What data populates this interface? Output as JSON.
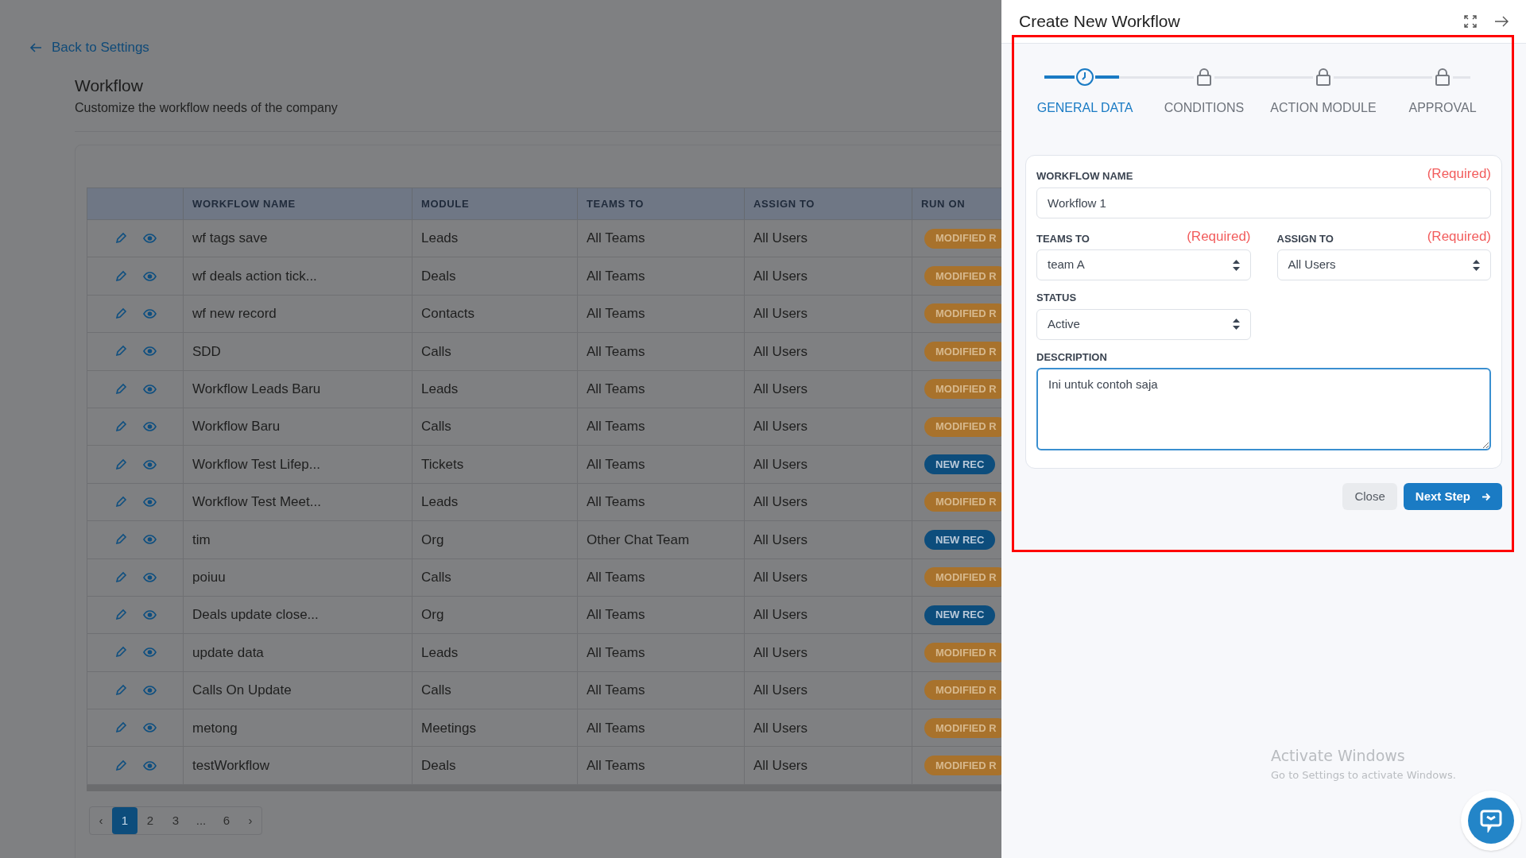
{
  "back_link": "Back to Settings",
  "page": {
    "title": "Workflow",
    "subtitle": "Customize the workflow needs of the company"
  },
  "table": {
    "columns": [
      "WORKFLOW NAME",
      "MODULE",
      "TEAMS TO",
      "ASSIGN TO",
      "RUN ON"
    ],
    "rows": [
      {
        "name": "wf tags save",
        "module": "Leads",
        "teams": "All Teams",
        "assign": "All Users",
        "run_on": {
          "text": "MODIFIED R",
          "kind": "modified"
        }
      },
      {
        "name": "wf deals action tick...",
        "module": "Deals",
        "teams": "All Teams",
        "assign": "All Users",
        "run_on": {
          "text": "MODIFIED R",
          "kind": "modified"
        }
      },
      {
        "name": "wf new record",
        "module": "Contacts",
        "teams": "All Teams",
        "assign": "All Users",
        "run_on": {
          "text": "MODIFIED R",
          "kind": "modified"
        }
      },
      {
        "name": "SDD",
        "module": "Calls",
        "teams": "All Teams",
        "assign": "All Users",
        "run_on": {
          "text": "MODIFIED R",
          "kind": "modified"
        }
      },
      {
        "name": "Workflow Leads Baru",
        "module": "Leads",
        "teams": "All Teams",
        "assign": "All Users",
        "run_on": {
          "text": "MODIFIED R",
          "kind": "modified"
        }
      },
      {
        "name": "Workflow Baru",
        "module": "Calls",
        "teams": "All Teams",
        "assign": "All Users",
        "run_on": {
          "text": "MODIFIED R",
          "kind": "modified"
        }
      },
      {
        "name": "Workflow Test Lifep...",
        "module": "Tickets",
        "teams": "All Teams",
        "assign": "All Users",
        "run_on": {
          "text": "NEW REC",
          "kind": "new"
        }
      },
      {
        "name": "Workflow Test Meet...",
        "module": "Leads",
        "teams": "All Teams",
        "assign": "All Users",
        "run_on": {
          "text": "MODIFIED R",
          "kind": "modified"
        }
      },
      {
        "name": "tim",
        "module": "Org",
        "teams": "Other Chat Team",
        "assign": "All Users",
        "run_on": {
          "text": "NEW REC",
          "kind": "new"
        }
      },
      {
        "name": "poiuu",
        "module": "Calls",
        "teams": "All Teams",
        "assign": "All Users",
        "run_on": {
          "text": "MODIFIED R",
          "kind": "modified"
        }
      },
      {
        "name": "Deals update close...",
        "module": "Org",
        "teams": "All Teams",
        "assign": "All Users",
        "run_on": {
          "text": "NEW REC",
          "kind": "new"
        }
      },
      {
        "name": "update data",
        "module": "Leads",
        "teams": "All Teams",
        "assign": "All Users",
        "run_on": {
          "text": "MODIFIED R",
          "kind": "modified"
        }
      },
      {
        "name": "Calls On Update",
        "module": "Calls",
        "teams": "All Teams",
        "assign": "All Users",
        "run_on": {
          "text": "MODIFIED R",
          "kind": "modified"
        }
      },
      {
        "name": "metong",
        "module": "Meetings",
        "teams": "All Teams",
        "assign": "All Users",
        "run_on": {
          "text": "MODIFIED R",
          "kind": "modified"
        }
      },
      {
        "name": "testWorkflow",
        "module": "Deals",
        "teams": "All Teams",
        "assign": "All Users",
        "run_on": {
          "text": "MODIFIED R",
          "kind": "modified"
        }
      }
    ]
  },
  "pagination": [
    {
      "label": "‹",
      "kind": "arrow",
      "selected": false
    },
    {
      "label": "1",
      "kind": "page",
      "selected": true
    },
    {
      "label": "2",
      "kind": "page",
      "selected": false
    },
    {
      "label": "3",
      "kind": "page",
      "selected": false
    },
    {
      "label": "...",
      "kind": "gap",
      "selected": false
    },
    {
      "label": "6",
      "kind": "page",
      "selected": false
    },
    {
      "label": "›",
      "kind": "arrow",
      "selected": false
    }
  ],
  "panel": {
    "title": "Create New Workflow",
    "steps": [
      {
        "label": "GENERAL DATA",
        "selected": true
      },
      {
        "label": "CONDITIONS",
        "selected": false
      },
      {
        "label": "ACTION MODULE",
        "selected": false
      },
      {
        "label": "APPROVAL",
        "selected": false
      }
    ],
    "workflow_name": {
      "label": "WORKFLOW NAME",
      "required": "(Required)",
      "value": "Workflow 1"
    },
    "teams_to": {
      "label": "TEAMS TO",
      "required": "(Required)",
      "value": "team A"
    },
    "assign_to": {
      "label": "ASSIGN TO",
      "required": "(Required)",
      "value": "All Users"
    },
    "status": {
      "label": "STATUS",
      "value": "Active"
    },
    "description": {
      "label": "DESCRIPTION",
      "value": "Ini untuk contoh saja"
    },
    "buttons": {
      "close": "Close",
      "next": "Next Step"
    }
  },
  "os_notice": {
    "title": "Activate Windows",
    "text": "Go to Settings to activate Windows."
  }
}
